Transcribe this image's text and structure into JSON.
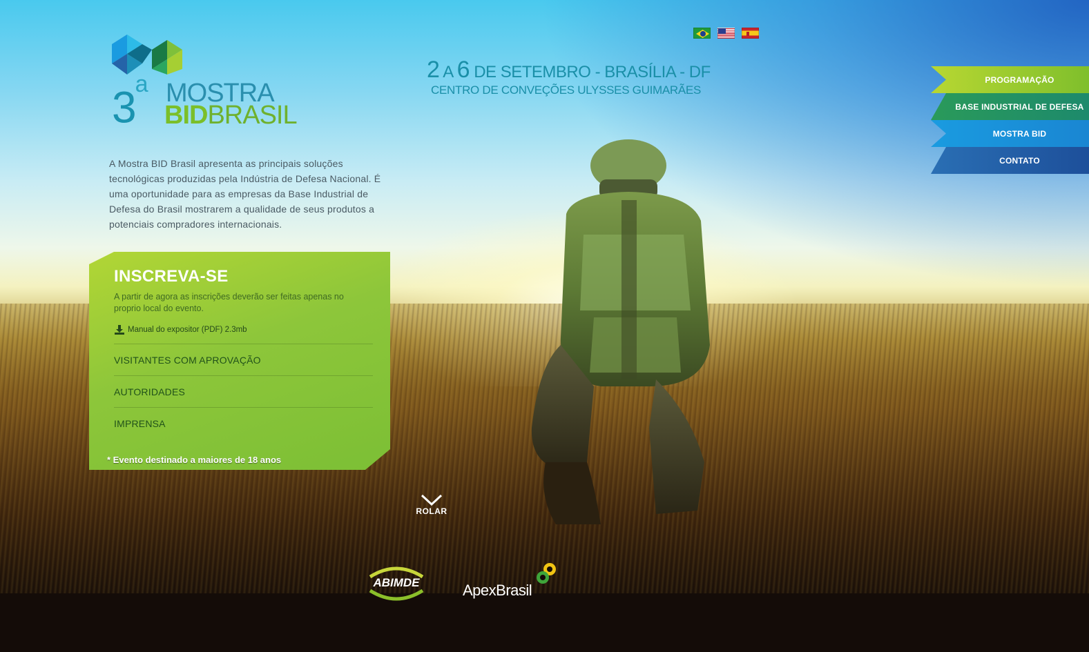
{
  "logo": {
    "ordinal": "3",
    "ordinal_sup": "a",
    "line1": "MOSTRA",
    "line2_bold": "BID",
    "line2_rest": "BRASIL"
  },
  "intro": "A Mostra BID Brasil apresenta as principais soluções tecnológicas produzidas pela Indústria de Defesa Nacional. É uma oportunidade para as empresas da Base Industrial de Defesa do Brasil mostrarem a qualidade de seus produtos a potenciais compradores internacionais.",
  "event": {
    "day_start": "2",
    "mid": " A ",
    "day_end": "6",
    "rest": " DE SETEMBRO - BRASÍLIA - DF",
    "venue": "CENTRO DE CONVEÇÕES ULYSSES GUIMARÃES"
  },
  "flags": [
    {
      "name": "brazil-flag-icon"
    },
    {
      "name": "usa-flag-icon"
    },
    {
      "name": "spain-flag-icon"
    }
  ],
  "nav": {
    "items": [
      {
        "label": "PROGRAMAÇÃO"
      },
      {
        "label": "BASE INDUSTRIAL DE DEFESA"
      },
      {
        "label": "MOSTRA BID"
      },
      {
        "label": "CONTATO"
      }
    ]
  },
  "register": {
    "title": "INSCREVA-SE",
    "text": "A partir de agora as inscrições deverão ser feitas apenas no proprio local do evento.",
    "manual": "Manual do expositor (PDF) 2.3mb",
    "links": [
      {
        "label": "VISITANTES COM APROVAÇÃO"
      },
      {
        "label": "AUTORIDADES"
      },
      {
        "label": "IMPRENSA"
      }
    ],
    "note": "* Evento destinado a maiores de 18 anos"
  },
  "scroll": {
    "label": "ROLAR"
  },
  "partners": {
    "abimde": "ABIMDE",
    "apex": "ApexBrasil"
  },
  "colors": {
    "accent_green": "#8dc63a",
    "accent_teal": "#1a8fa8",
    "nav_green": "#b8d732",
    "nav_teal": "#2a9a5a",
    "nav_blue": "#1a9be0",
    "nav_navy": "#2a6fb4"
  }
}
